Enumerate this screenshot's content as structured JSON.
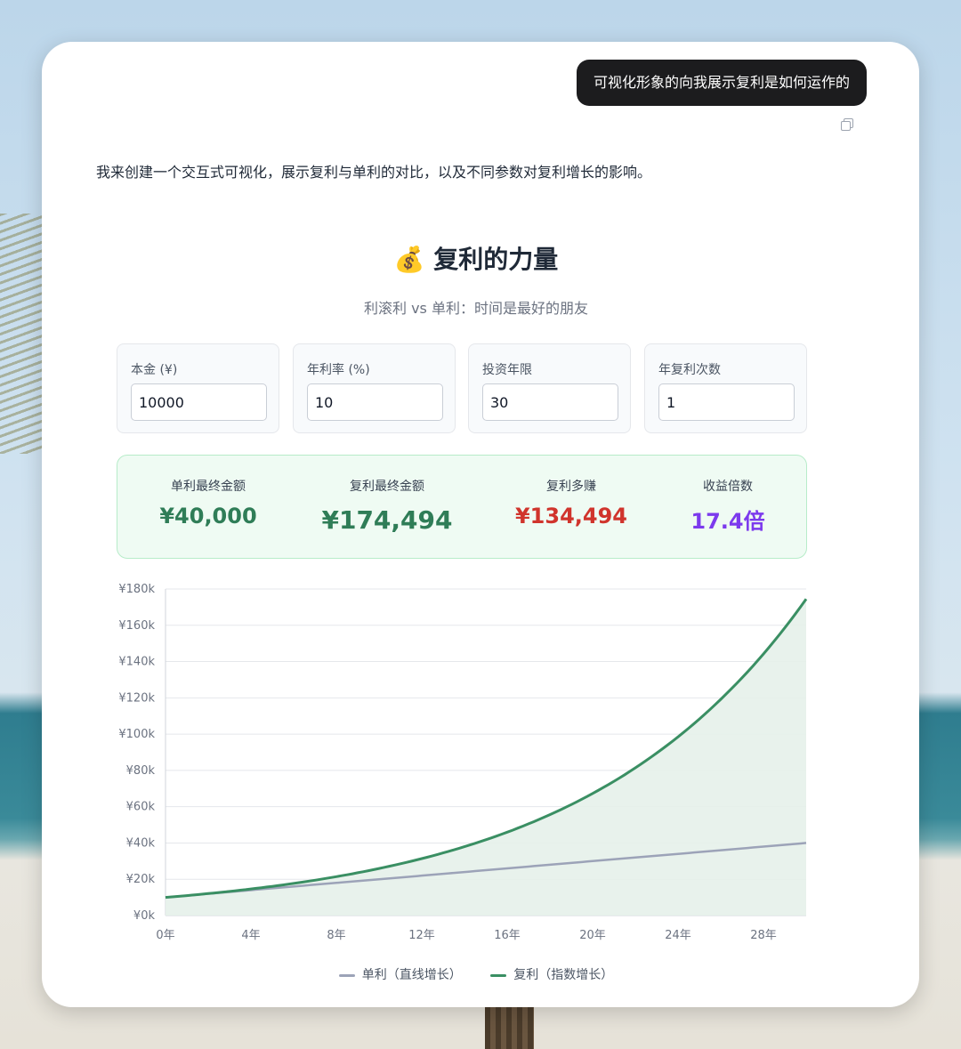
{
  "chat": {
    "user_message": "可视化形象的向我展示复利是如何运作的",
    "assistant_intro": "我来创建一个交互式可视化，展示复利与单利的对比，以及不同参数对复利增长的影响。"
  },
  "viz": {
    "emoji": "💰",
    "title": "复利的力量",
    "subtitle": "利滚利 vs 单利：时间是最好的朋友"
  },
  "params": [
    {
      "label": "本金 (¥)",
      "value": "10000"
    },
    {
      "label": "年利率 (%)",
      "value": "10"
    },
    {
      "label": "投资年限",
      "value": "30"
    },
    {
      "label": "年复利次数",
      "value": "1"
    }
  ],
  "results": [
    {
      "label": "单利最终金额",
      "value": "¥40,000",
      "color": "#2f7d57"
    },
    {
      "label": "复利最终金额",
      "value": "¥174,494",
      "color": "#2f7d57"
    },
    {
      "label": "复利多赚",
      "value": "¥134,494",
      "color": "#d0342c"
    },
    {
      "label": "收益倍数",
      "value": "17.4倍",
      "color": "#7c3aed"
    }
  ],
  "chart_data": {
    "type": "area",
    "x_label_suffix": "年",
    "y_ticks": [
      "¥0k",
      "¥20k",
      "¥40k",
      "¥60k",
      "¥80k",
      "¥100k",
      "¥120k",
      "¥140k",
      "¥160k",
      "¥180k"
    ],
    "x_ticks": [
      "0年",
      "4年",
      "8年",
      "12年",
      "16年",
      "20年",
      "24年",
      "28年"
    ],
    "ylim": [
      0,
      180000
    ],
    "xlim": [
      0,
      30
    ],
    "principal": 10000,
    "rate": 0.1,
    "years": 30,
    "series": [
      {
        "name": "单利（直线增长）",
        "color": "#9ca3b8",
        "formula": "simple"
      },
      {
        "name": "复利（指数增长）",
        "color": "#3a8f63",
        "formula": "compound"
      }
    ]
  },
  "colors": {
    "compound_fill": "#e6f1ea",
    "grid": "#e5e7eb"
  },
  "icons": {
    "copy": "copy-icon"
  }
}
